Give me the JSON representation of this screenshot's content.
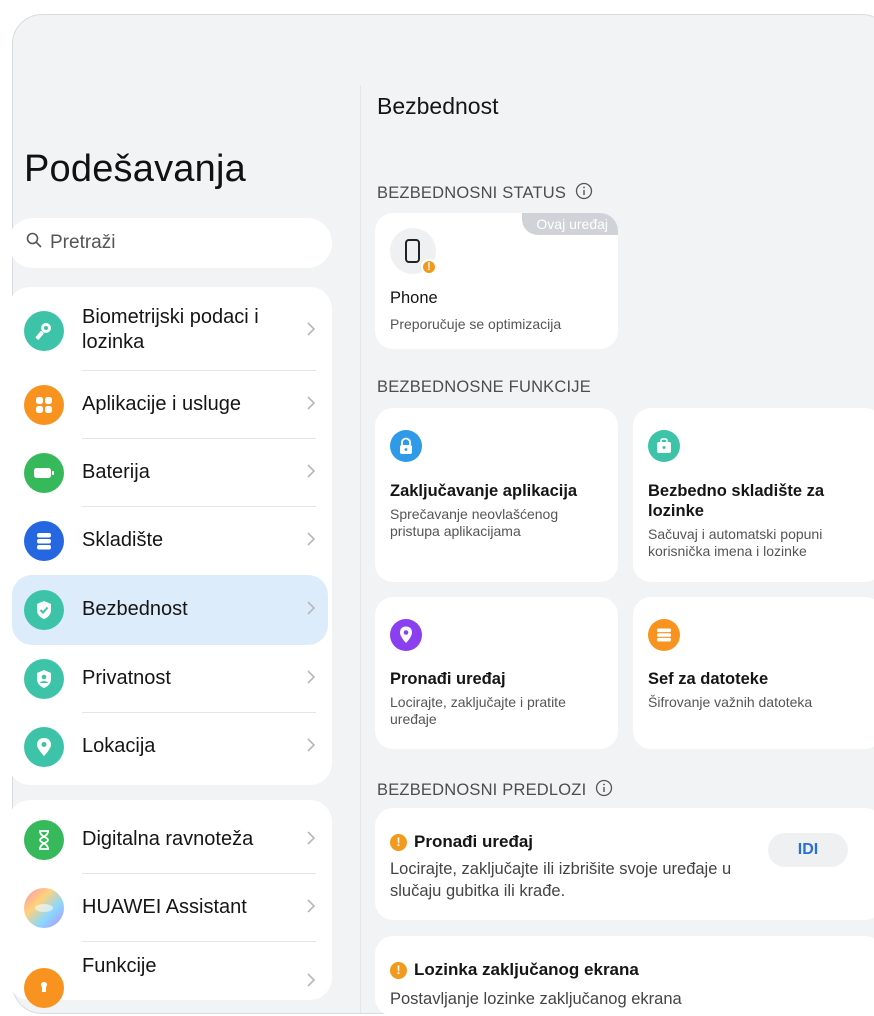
{
  "left": {
    "title": "Podešavanja",
    "search_placeholder": "Pretraži",
    "items": [
      {
        "label": "Biometrijski podaci i lozinka",
        "icon": "key-icon",
        "color": "#3dc4a8"
      },
      {
        "label": "Aplikacije i usluge",
        "icon": "apps-icon",
        "color": "#f7931e"
      },
      {
        "label": "Baterija",
        "icon": "battery-icon",
        "color": "#36b95a"
      },
      {
        "label": "Skladište",
        "icon": "storage-icon",
        "color": "#2467e0"
      },
      {
        "label": "Bezbednost",
        "icon": "shield-check-icon",
        "color": "#3dc4a8"
      },
      {
        "label": "Privatnost",
        "icon": "privacy-icon",
        "color": "#3dc4a8"
      },
      {
        "label": "Lokacija",
        "icon": "location-icon",
        "color": "#3dc4a8"
      },
      {
        "label": "Digitalna ravnoteža",
        "icon": "hourglass-icon",
        "color": "#36b95a"
      },
      {
        "label": "HUAWEI Assistant",
        "icon": "assistant-icon",
        "color": "#9b6ff0"
      },
      {
        "label": "Funkcije",
        "icon": "features-icon",
        "color": "#f7931e"
      }
    ]
  },
  "right": {
    "title": "Bezbednost",
    "status_section": "BEZBEDNOSNI STATUS",
    "device_card": {
      "badge": "Ovaj uređaj",
      "title": "Phone",
      "subtitle": "Preporučuje se optimizacija"
    },
    "features_section": "BEZBEDNOSNE FUNKCIJE",
    "features": [
      {
        "title": "Zaključavanje aplikacija",
        "subtitle": "Sprečavanje neovlašćenog pristupa aplikacijama",
        "icon": "lock-icon",
        "color": "#2f9ae8"
      },
      {
        "title": "Bezbedno skladište za lozinke",
        "subtitle": "Sačuvaj i automatski popuni korisnička imena i lozinke",
        "icon": "password-vault-icon",
        "color": "#3dc4a8"
      },
      {
        "title": "Pronađi uređaj",
        "subtitle": "Locirajte, zaključajte i pratite uređaje",
        "icon": "find-device-icon",
        "color": "#8a3ff0"
      },
      {
        "title": "Sef za datoteke",
        "subtitle": "Šifrovanje važnih datoteka",
        "icon": "file-safe-icon",
        "color": "#f7931e"
      }
    ],
    "suggestions_section": "BEZBEDNOSNI PREDLOZI",
    "suggestions": [
      {
        "title": "Pronađi uređaj",
        "desc": "Locirajte, zaključajte ili izbrišite svoje uređaje u slučaju gubitka ili krađe.",
        "button": "IDI"
      },
      {
        "title": "Lozinka zaključanog ekrana",
        "desc": "Postavljanje lozinke zaključanog ekrana"
      }
    ]
  }
}
